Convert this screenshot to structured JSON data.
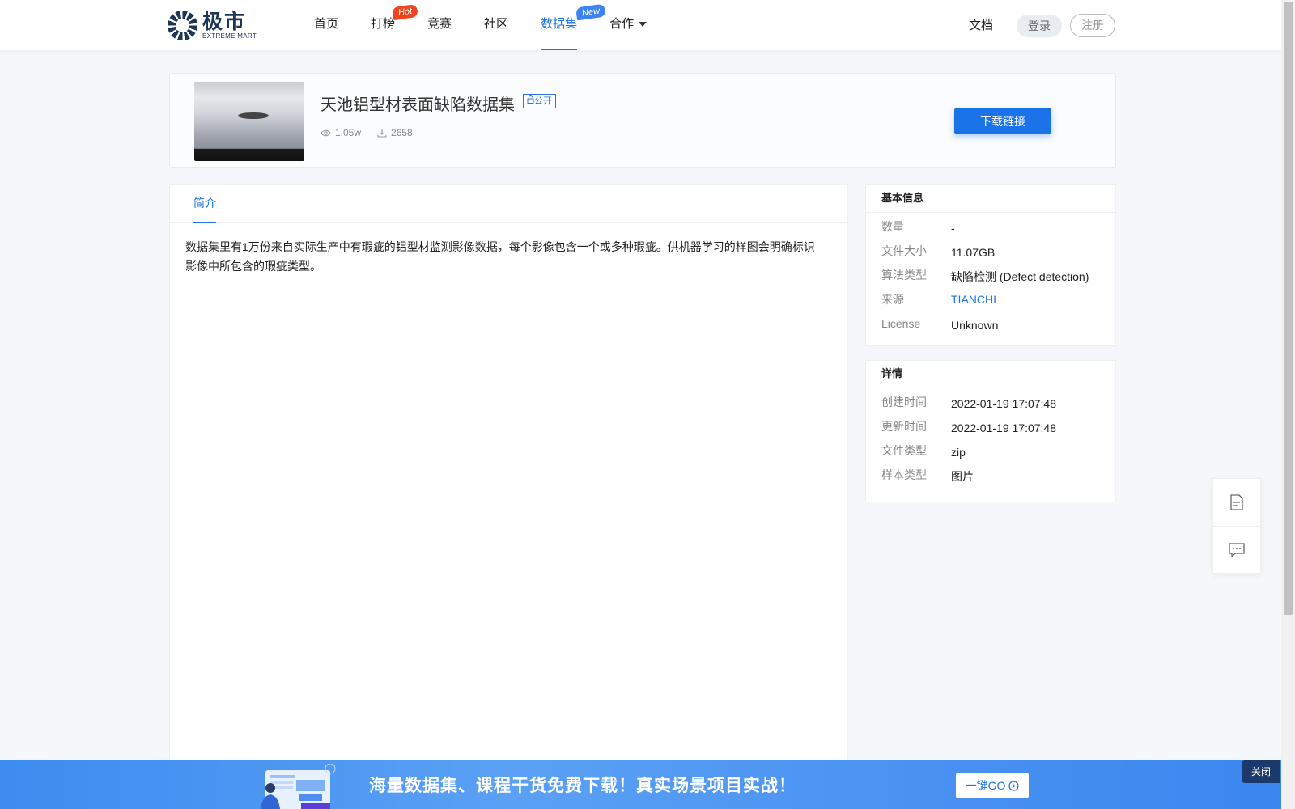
{
  "header": {
    "logo_cn": "极市",
    "logo_en": "EXTREME MART",
    "nav": [
      {
        "label": "首页"
      },
      {
        "label": "打榜",
        "badge": "Hot"
      },
      {
        "label": "竞赛"
      },
      {
        "label": "社区"
      },
      {
        "label": "数据集",
        "badge": "New",
        "active": true
      },
      {
        "label": "合作"
      }
    ],
    "docs": "文档",
    "login": "登录",
    "register": "注册"
  },
  "dataset": {
    "title": "天池铝型材表面缺陷数据集",
    "visibility": "公开",
    "views": "1.05w",
    "downloads": "2658",
    "download_button": "下载链接"
  },
  "intro": {
    "tab": "简介",
    "text": "数据集里有1万份来自实际生产中有瑕疵的铝型材监测影像数据，每个影像包含一个或多种瑕疵。供机器学习的样图会明确标识影像中所包含的瑕疵类型。"
  },
  "basic_info": {
    "title": "基本信息",
    "rows": [
      {
        "key": "数量",
        "value": "-"
      },
      {
        "key": "文件大小",
        "value": "11.07GB"
      },
      {
        "key": "算法类型",
        "value": "缺陷检测 (Defect detection)"
      },
      {
        "key": "来源",
        "value": "TIANCHI"
      },
      {
        "key": "License",
        "value": "Unknown"
      }
    ]
  },
  "details": {
    "title": "详情",
    "rows": [
      {
        "key": "创建时间",
        "value": "2022-01-19 17:07:48"
      },
      {
        "key": "更新时间",
        "value": "2022-01-19 17:07:48"
      },
      {
        "key": "文件类型",
        "value": "zip"
      },
      {
        "key": "样本类型",
        "value": "图片"
      }
    ]
  },
  "banner": {
    "text": "海量数据集、课程干货免费下载！真实场景项目实战！",
    "go_button": "一键GO",
    "close": "关闭"
  },
  "colors": {
    "accent": "#1a73e8",
    "hot_badge": "#f0441e",
    "new_badge": "#3b82f6",
    "banner_bg": "#3d8cf0",
    "close_bg": "#1b3a6b"
  },
  "icons": {
    "views": "eye-icon",
    "downloads": "download-icon",
    "float_top": "document-icon",
    "float_bottom": "chat-icon",
    "go": "circle-arrow-icon"
  }
}
